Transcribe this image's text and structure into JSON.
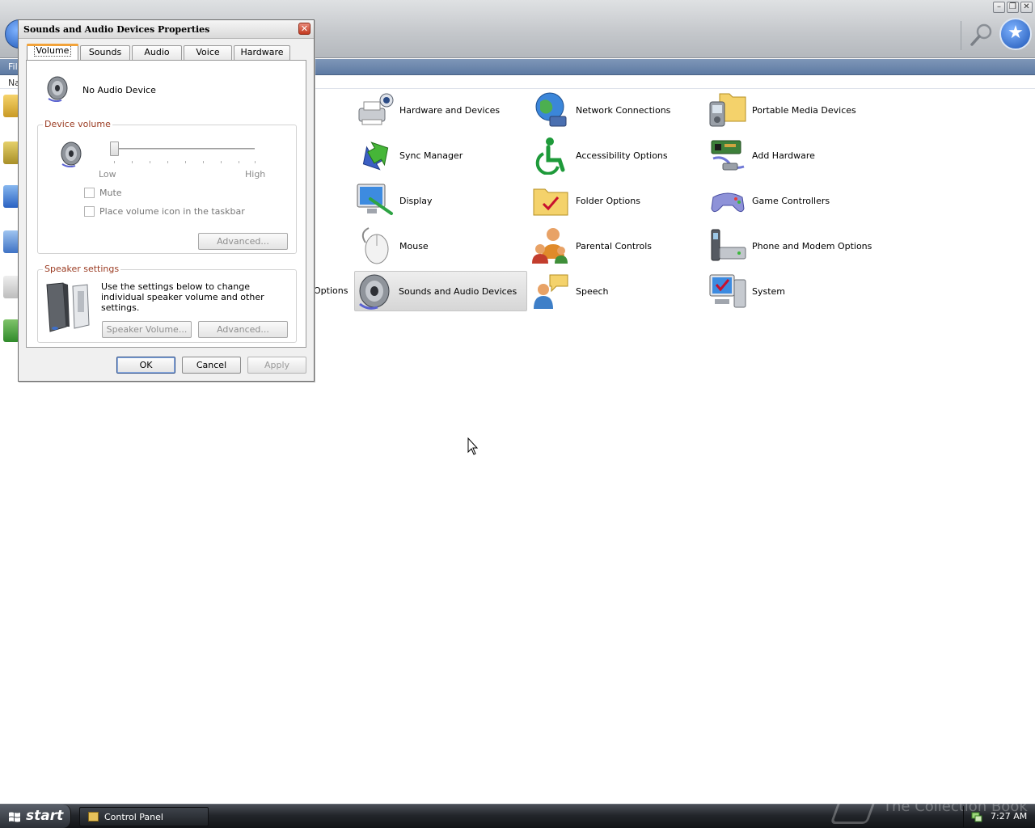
{
  "control_panel": {
    "menu_file": "File",
    "address_label": "Na",
    "partial_item_label": "Options",
    "items": [
      {
        "label": "Hardware and Devices"
      },
      {
        "label": "Network Connections"
      },
      {
        "label": "Portable Media Devices"
      },
      {
        "label": "Sync Manager"
      },
      {
        "label": "Accessibility Options"
      },
      {
        "label": "Add Hardware"
      },
      {
        "label": "Display"
      },
      {
        "label": "Folder Options"
      },
      {
        "label": "Game Controllers"
      },
      {
        "label": "Mouse"
      },
      {
        "label": "Parental Controls"
      },
      {
        "label": "Phone and Modem Options"
      },
      {
        "label": "Sounds and Audio Devices"
      },
      {
        "label": "Speech"
      },
      {
        "label": "System"
      }
    ]
  },
  "dialog": {
    "title": "Sounds and Audio Devices Properties",
    "close_glyph": "✕",
    "tabs": [
      {
        "label": "Volume",
        "active": true
      },
      {
        "label": "Sounds"
      },
      {
        "label": "Audio"
      },
      {
        "label": "Voice"
      },
      {
        "label": "Hardware"
      }
    ],
    "device_name": "No Audio Device",
    "device_volume": {
      "title": "Device volume",
      "low_label": "Low",
      "high_label": "High",
      "level": 0,
      "mute_label": "Mute",
      "taskbar_icon_label": "Place volume icon in the taskbar",
      "advanced_label": "Advanced..."
    },
    "speaker_settings": {
      "title": "Speaker settings",
      "description": "Use the settings below to change individual speaker volume and other settings.",
      "speaker_volume_label": "Speaker Volume...",
      "advanced_label": "Advanced..."
    },
    "buttons": {
      "ok": "OK",
      "cancel": "Cancel",
      "apply": "Apply"
    }
  },
  "taskbar": {
    "start_label": "start",
    "task_label": "Control Panel",
    "watermark": "The Collection Book",
    "clock": "7:27 AM"
  },
  "colors": {
    "group_title": "#9b3c23",
    "active_tab_accent": "#f2a33a",
    "taskbar_bg": "#23262b"
  }
}
